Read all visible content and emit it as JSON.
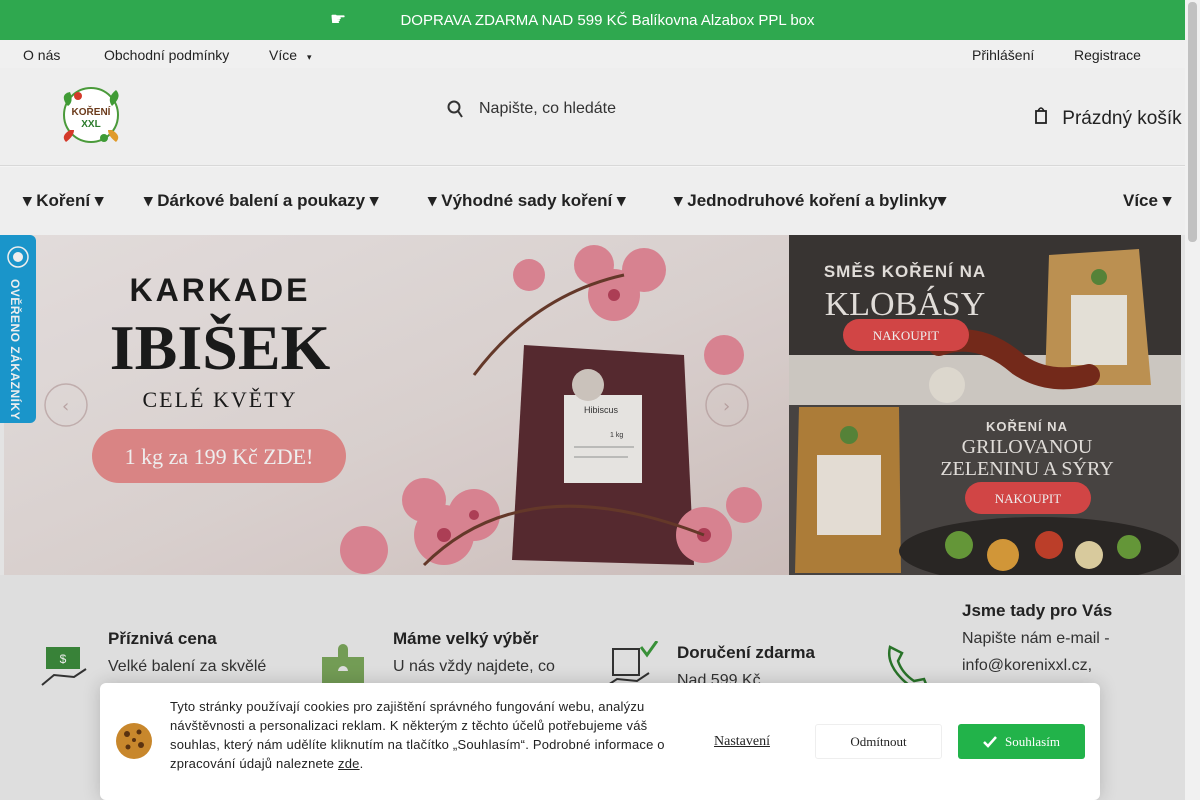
{
  "topbar": {
    "text": " DOPRAVA ZDARMA NAD 599 KČ   Balíkovna  Alzabox  PPL box "
  },
  "infonav": {
    "about": "O nás",
    "terms": "Obchodní podmínky",
    "more": "Více",
    "login": "Přihlášení",
    "register": "Registrace"
  },
  "header": {
    "search_placeholder": "Napište, co hledáte",
    "cart_label": "Prázdný košík"
  },
  "menu": {
    "items": [
      "Koření",
      "Dárkové balení a poukazy",
      "Výhodné sady koření",
      "Jednodruhové koření a bylinky"
    ],
    "more": "Více"
  },
  "hero": {
    "line1": "KARKADE",
    "line2": "IBIŠEK",
    "line3": "CELÉ KVĚTY",
    "cta": "1 kg za 199 Kč ZDE!",
    "bag_label": "Hibiscus",
    "bag_weight": "1 kg"
  },
  "promo_top": {
    "line1": "SMĚS KOŘENÍ NA",
    "line2": "KLOBÁSY",
    "cta": "NAKOUPIT"
  },
  "promo_bottom": {
    "line1": "KOŘENÍ NA",
    "line2": "GRILOVANOU",
    "line3": "ZELENINU A SÝRY",
    "cta": "NAKOUPIT"
  },
  "verified": {
    "text": "OVĚŘENO ZÁKAZNÍKY"
  },
  "logo": {
    "text1": "KOŘENÍ",
    "text2": "XXL"
  },
  "benefits": [
    {
      "title": "Příznivá cena",
      "desc": "Velké balení za skvělé"
    },
    {
      "title": "Máme velký výběr",
      "desc": "U nás vždy najdete, co"
    },
    {
      "title": "Doručení zdarma",
      "desc": "Nad 599 Kč"
    },
    {
      "title": "Jsme tady pro Vás",
      "desc": "Napište nám e-mail -",
      "desc2": "info@korenixxl.cz,"
    }
  ],
  "cookie": {
    "text": "Tyto stránky používají cookies pro zajištění správného fungování webu, analýzu návštěvnosti a personalizaci reklam. K některým z těchto účelů potřebujeme váš souhlas, který nám udělíte kliknutím na tlačítko „Souhlasím“. Podrobné informace o zpracování údajů naleznete",
    "link": "zde",
    "settings": "Nastavení",
    "deny": "Odmítnout",
    "accept": "Souhlasím"
  },
  "colors": {
    "brand_green": "#2fa84f",
    "verified_blue": "#1a9fd8",
    "accept_green": "#22b34a",
    "promo_red": "#e04848"
  }
}
